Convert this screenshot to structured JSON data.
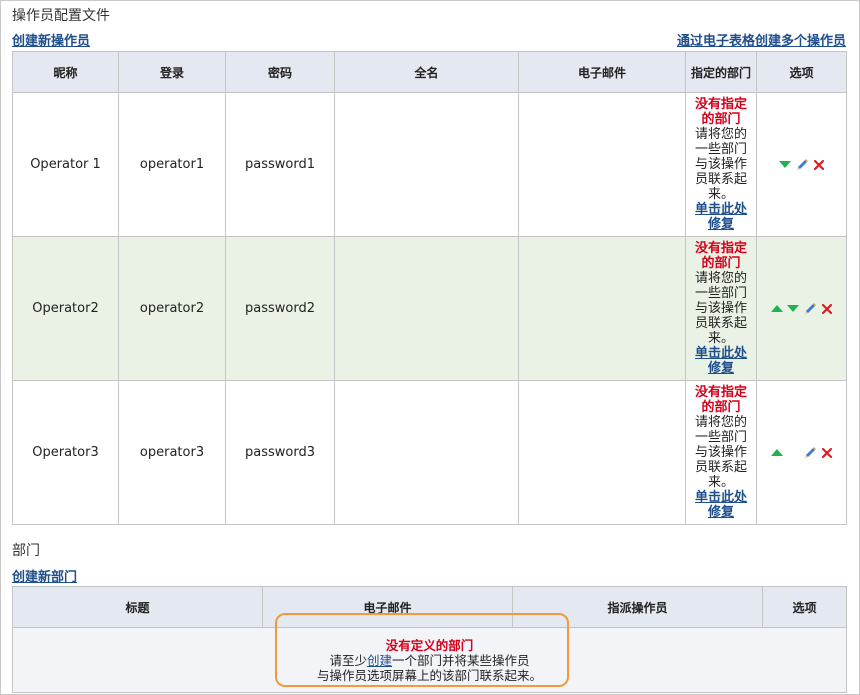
{
  "operators_section": {
    "title": "操作员配置文件",
    "create_link": "创建新操作员",
    "spreadsheet_link": "通过电子表格创建多个操作员",
    "columns": [
      "昵称",
      "登录",
      "密码",
      "全名",
      "电子邮件",
      "指定的部门",
      "选项"
    ],
    "rows": [
      {
        "nickname": "Operator 1",
        "login": "operator1",
        "password": "password1",
        "fullname": "",
        "email": "",
        "dept_warning": "没有指定的部门",
        "dept_message": "请将您的一些部门与该操作员联系起来。",
        "dept_fix": "单击此处修复",
        "can_move_up": false,
        "can_move_down": true
      },
      {
        "nickname": "Operator2",
        "login": "operator2",
        "password": "password2",
        "fullname": "",
        "email": "",
        "dept_warning": "没有指定的部门",
        "dept_message": "请将您的一些部门与该操作员联系起来。",
        "dept_fix": "单击此处修复",
        "can_move_up": true,
        "can_move_down": true
      },
      {
        "nickname": "Operator3",
        "login": "operator3",
        "password": "password3",
        "fullname": "",
        "email": "",
        "dept_warning": "没有指定的部门",
        "dept_message": "请将您的一些部门与该操作员联系起来。",
        "dept_fix": "单击此处修复",
        "can_move_up": true,
        "can_move_down": false
      }
    ]
  },
  "departments_section": {
    "title": "部门",
    "create_link": "创建新部门",
    "columns": [
      "标题",
      "电子邮件",
      "指派操作员",
      "选项"
    ],
    "empty_title": "没有定义的部门",
    "empty_line1_before": "请至少",
    "empty_line1_link": "创建",
    "empty_line1_after": "一个部门并将某些操作员",
    "empty_line2": "与操作员选项屏幕上的该部门联系起来。"
  },
  "colors": {
    "accent_link": "#1f4e8c",
    "warning": "#d4001b",
    "header_bg": "#e4e8f0",
    "alt_row": "#eaf2e5",
    "callout": "#f29a3b",
    "arrow": "#1db34f"
  }
}
